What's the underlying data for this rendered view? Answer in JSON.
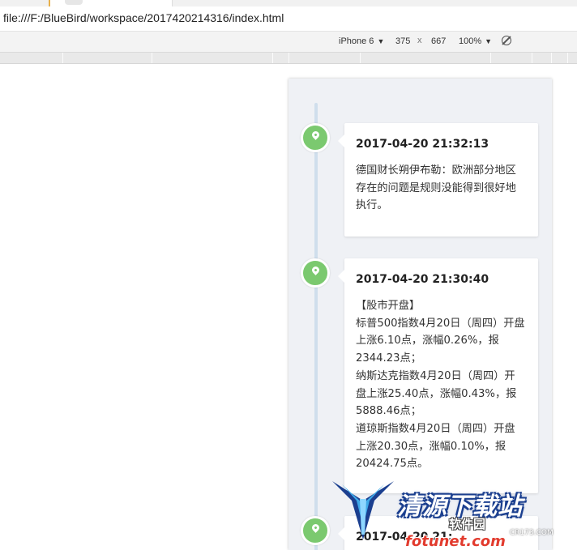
{
  "browser": {
    "url": "file:///F:/BlueBird/workspace/2017420214316/index.html"
  },
  "devtools": {
    "device": "iPhone 6",
    "width": "375",
    "times": "x",
    "height": "667",
    "zoom": "100%"
  },
  "timeline": [
    {
      "time": "2017-04-20 21:32:13",
      "lines": [
        "德国财长朔伊布勒：欧洲部分地区",
        "存在的问题是规则没能得到很好地",
        "执行。"
      ]
    },
    {
      "time": "2017-04-20 21:30:40",
      "lines": [
        "【股市开盘】",
        "标普500指数4月20日（周四）开盘",
        "上涨6.10点，涨幅0.26%，报",
        "2344.23点；",
        "纳斯达克指数4月20日（周四）开",
        "盘上涨25.40点，涨幅0.43%，报",
        "5888.46点；",
        "道琼斯指数4月20日（周四）开盘",
        "上涨20.30点，涨幅0.10%，报",
        "20424.75点。"
      ]
    },
    {
      "time": "2017-04-20 21:",
      "lines": []
    }
  ],
  "watermark": {
    "title": "清源下载站",
    "sub1": "软件园",
    "sub2": "CR173.COM",
    "url_part": "fotunet.com"
  },
  "colors": {
    "marker": "#7bc96f",
    "timeline_line": "#cfdeec",
    "viewport_bg": "#eff1f5"
  }
}
